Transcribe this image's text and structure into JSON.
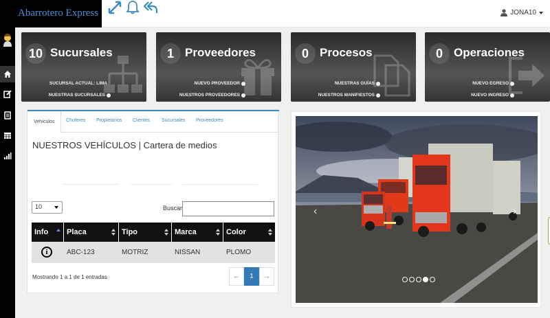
{
  "header": {
    "brand": "Abarrotero Express",
    "user": "JONA10",
    "icons": [
      "expand-icon",
      "bell-icon",
      "reply-all-icon"
    ]
  },
  "sidebar": {
    "items": [
      "home-icon",
      "edit-icon",
      "document-list-icon",
      "calendar-icon",
      "bar-chart-icon"
    ]
  },
  "cards": [
    {
      "count": "10",
      "title": "Sucursales",
      "links": [
        "SUCURSAL ACTUAL: LIMA",
        "NUESTRAS SUCURSALES"
      ],
      "icon": "sitemap-icon"
    },
    {
      "count": "1",
      "title": "Proveedores",
      "links": [
        "NUEVO PROVEEDOR",
        "NUESTROS PROVEEDORES"
      ],
      "icon": "gift-icon"
    },
    {
      "count": "0",
      "title": "Procesos",
      "links": [
        "NUESTRAS GUÍAS",
        "NUESTROS MANIFIESTOS"
      ],
      "icon": "files-icon"
    },
    {
      "count": "0",
      "title": "Operaciones",
      "links": [
        "NUEVO EGRESO",
        "NUEVO INGRESO"
      ],
      "icon": "exit-icon"
    }
  ],
  "vehicles": {
    "tabs": [
      "Vehículos",
      "Choferes",
      "Propietarios",
      "Clientes",
      "Sucursales",
      "Proveedores"
    ],
    "title": "NUESTROS VEHÍCULOS | Cartera de medios",
    "page_length": "10",
    "search_label": "Buscar:",
    "columns": [
      "Info",
      "Placa",
      "Tipo",
      "Marca",
      "Color"
    ],
    "rows": [
      {
        "placa": "ABC-123",
        "tipo": "MOTRIZ",
        "marca": "NISSAN",
        "color": "PLOMO"
      }
    ],
    "info_text": "Mostrando 1 a 1 de 1 entradas",
    "pagination": {
      "prev": "←",
      "current": "1",
      "next": "→"
    }
  },
  "carousel": {
    "prev": "‹",
    "next": "›",
    "slide_count": 5,
    "active_slide": 4
  }
}
